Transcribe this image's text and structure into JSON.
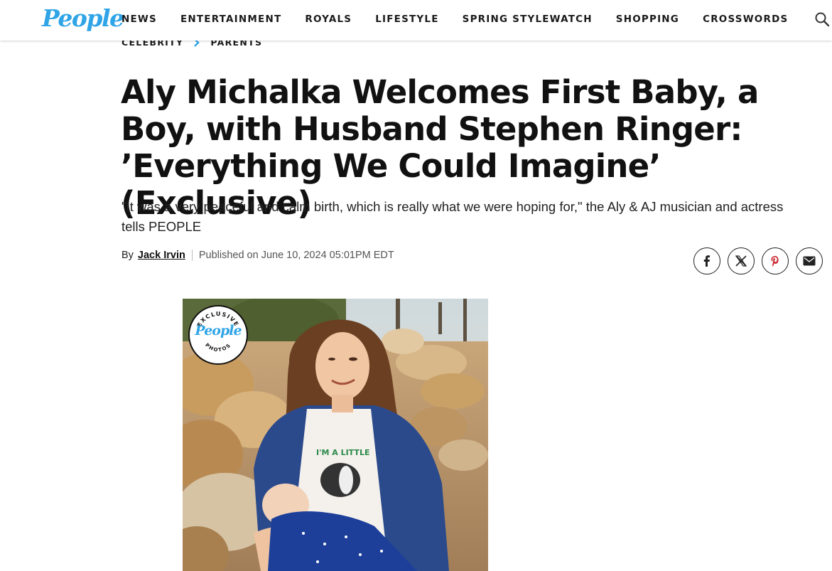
{
  "brand": {
    "logo": "People"
  },
  "nav": {
    "items": [
      "NEWS",
      "ENTERTAINMENT",
      "ROYALS",
      "LIFESTYLE",
      "SPRING STYLEWATCH",
      "SHOPPING",
      "CROSSWORDS"
    ],
    "search_icon": "search-icon"
  },
  "breadcrumb": {
    "items": [
      "CELEBRITY",
      "PARENTS"
    ]
  },
  "article": {
    "headline": "Aly Michalka Welcomes First Baby, a Boy, with Husband Stephen Ringer: ’Everything We Could Imagine’ (Exclusive)",
    "dek": "\"It was a very peaceful and calm birth, which is really what we were hoping for,\" the Aly & AJ musician and actress tells PEOPLE",
    "byline_prefix": "By",
    "author": "Jack Irvin",
    "published": "Published on June 10, 2024 05:01PM EDT"
  },
  "share": {
    "icons": [
      "facebook-icon",
      "x-icon",
      "pinterest-icon",
      "email-icon"
    ]
  },
  "hero": {
    "badge_top": "EXCLUSIVE",
    "badge_logo": "People",
    "badge_bottom": "PHOTOS",
    "shirt_text": "I'm A Little Stinker"
  },
  "colors": {
    "brand_blue": "#2fa4e7",
    "text": "#111111",
    "pinterest": "#c8232c"
  }
}
